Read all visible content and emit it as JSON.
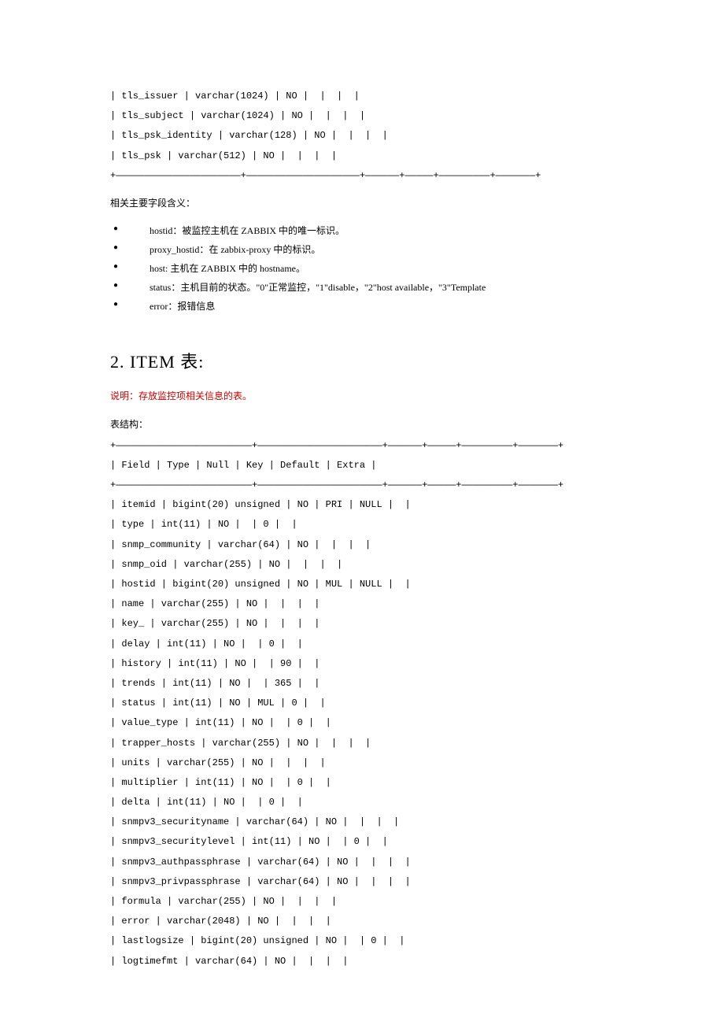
{
  "host_table": {
    "rows": [
      "| tls_issuer | varchar(1024) | NO |  |  |  |",
      "| tls_subject | varchar(1024) | NO |  |  |  |",
      "| tls_psk_identity | varchar(128) | NO |  |  |  |",
      "| tls_psk | varchar(512) | NO |  |  |  |"
    ],
    "sep": "+——————————————————————+————————————————————+——————+—————+—————————+———————+"
  },
  "fields_meaning_heading": "相关主要字段含义：",
  "bullets": [
    "hostid：被监控主机在 ZABBIX 中的唯一标识。",
    "proxy_hostid：在 zabbix-proxy 中的标识。",
    "host: 主机在 ZABBIX 中的 hostname。",
    "status：主机目前的状态。\"0\"正常监控，\"1\"disable，\"2\"host available，\"3\"Template",
    "error：报错信息"
  ],
  "section2": {
    "title": "2.  ITEM 表:",
    "desc": "说明：存放监控项相关信息的表。",
    "struct_label": "表结构：",
    "sep_top": "+————————————————————————+——————————————————————+——————+—————+—————————+———————+",
    "header": "| Field | Type | Null | Key | Default | Extra |",
    "sep_mid": "+————————————————————————+——————————————————————+——————+—————+—————————+———————+",
    "rows": [
      "| itemid | bigint(20) unsigned | NO | PRI | NULL |  |",
      "| type | int(11) | NO |  | 0 |  |",
      "| snmp_community | varchar(64) | NO |  |  |  |",
      "| snmp_oid | varchar(255) | NO |  |  |  |",
      "| hostid | bigint(20) unsigned | NO | MUL | NULL |  |",
      "| name | varchar(255) | NO |  |  |  |",
      "| key_ | varchar(255) | NO |  |  |  |",
      "| delay | int(11) | NO |  | 0 |  |",
      "| history | int(11) | NO |  | 90 |  |",
      "| trends | int(11) | NO |  | 365 |  |",
      "| status | int(11) | NO | MUL | 0 |  |",
      "| value_type | int(11) | NO |  | 0 |  |",
      "| trapper_hosts | varchar(255) | NO |  |  |  |",
      "| units | varchar(255) | NO |  |  |  |",
      "| multiplier | int(11) | NO |  | 0 |  |",
      "| delta | int(11) | NO |  | 0 |  |",
      "| snmpv3_securityname | varchar(64) | NO |  |  |  |",
      "| snmpv3_securitylevel | int(11) | NO |  | 0 |  |",
      "| snmpv3_authpassphrase | varchar(64) | NO |  |  |  |",
      "| snmpv3_privpassphrase | varchar(64) | NO |  |  |  |",
      "| formula | varchar(255) | NO |  |  |  |",
      "| error | varchar(2048) | NO |  |  |  |",
      "| lastlogsize | bigint(20) unsigned | NO |  | 0 |  |",
      "| logtimefmt | varchar(64) | NO |  |  |  |"
    ]
  }
}
